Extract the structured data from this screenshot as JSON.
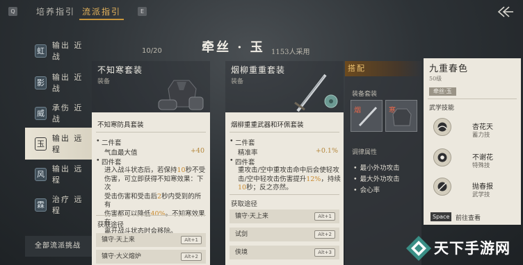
{
  "top_bar": {
    "q_key": "Q",
    "tab_cultivate": "培养指引",
    "tab_school": "流派指引",
    "e_key": "E"
  },
  "left_list": {
    "count": "10/20",
    "items": [
      {
        "seal": "虹",
        "label": "输出 近战"
      },
      {
        "seal": "影",
        "label": "输出 近战"
      },
      {
        "seal": "威",
        "label": "承伤 近战"
      },
      {
        "seal": "玉",
        "label": "输出 远程"
      },
      {
        "seal": "风",
        "label": "输出 远程"
      },
      {
        "seal": "霖",
        "label": "治疗 远程"
      }
    ],
    "challenge_button": "全部流派挑战"
  },
  "header": {
    "title": "牵丝 · 玉",
    "adopt_count": "1153人采用"
  },
  "card1": {
    "name": "不知寒套装",
    "sub": "装备",
    "body_title": "不知寒防具套装",
    "bonus2_label": "二件套",
    "bonus2_stat": "气血最大值",
    "bonus2_value": "+40",
    "bonus4_label": "四件套",
    "desc_lines": [
      [
        "进入战斗状态后，若保持",
        "10",
        "秒不受"
      ],
      [
        "伤害，可立即获得不知寒效果：下次"
      ],
      [
        "受击伤害和受击后",
        "2",
        "秒内受到的所有"
      ],
      [
        "伤害都可以降低",
        "40%",
        "。不知寒效果在"
      ],
      [
        "离开战斗状态时会移除。"
      ]
    ],
    "source_title": "获取途径",
    "sources": [
      {
        "label": "镇守·天上来",
        "key": "Alt+1"
      },
      {
        "label": "镇守·大义熔炉",
        "key": "Alt+2"
      }
    ]
  },
  "card2": {
    "name": "烟柳重重套装",
    "sub": "装备",
    "body_title": "烟柳重重武器和环佩套装",
    "bonus2_label": "二件套",
    "bonus2_stat": "精准率",
    "bonus2_value": "+0.1%",
    "bonus4_label": "四件套",
    "desc_lines": [
      [
        "重攻击/空中重攻击命中后会使轻攻"
      ],
      [
        "击/空中轻攻击伤害提升",
        "12%",
        "，持续"
      ],
      [
        "",
        "10",
        "秒；反之亦然。"
      ]
    ],
    "source_title": "获取途径",
    "sources": [
      {
        "label": "镇守·天上来",
        "key": "Alt+1"
      },
      {
        "label": "试剑",
        "key": "Alt+2"
      },
      {
        "label": "侠境",
        "key": "Alt+3"
      }
    ]
  },
  "pairing": {
    "title": "搭配",
    "equip_label": "装备套装",
    "slot1_tag": "烟",
    "slot2_tag": "寒",
    "tune_label": "调律属性",
    "attrs": [
      "最小外功攻击",
      "最大外功攻击",
      "会心率"
    ]
  },
  "right_panel": {
    "title": "九重春色",
    "level": "50级",
    "tag": "牵丝·玉",
    "sub": "武学技能",
    "skills": [
      {
        "name": "杏花天",
        "type": "蓄力技"
      },
      {
        "name": "不谢花",
        "type": "特殊技"
      },
      {
        "name": "抛春报",
        "type": "武学技"
      }
    ],
    "space_key": "Space",
    "view_label": "前往查看"
  },
  "watermark": {
    "text": "天下手游网"
  },
  "colors": {
    "accent_gold": "#e4b35c",
    "highlight": "#c98a2e",
    "paper": "#ece8de",
    "dark_bg": "#2d3236"
  }
}
